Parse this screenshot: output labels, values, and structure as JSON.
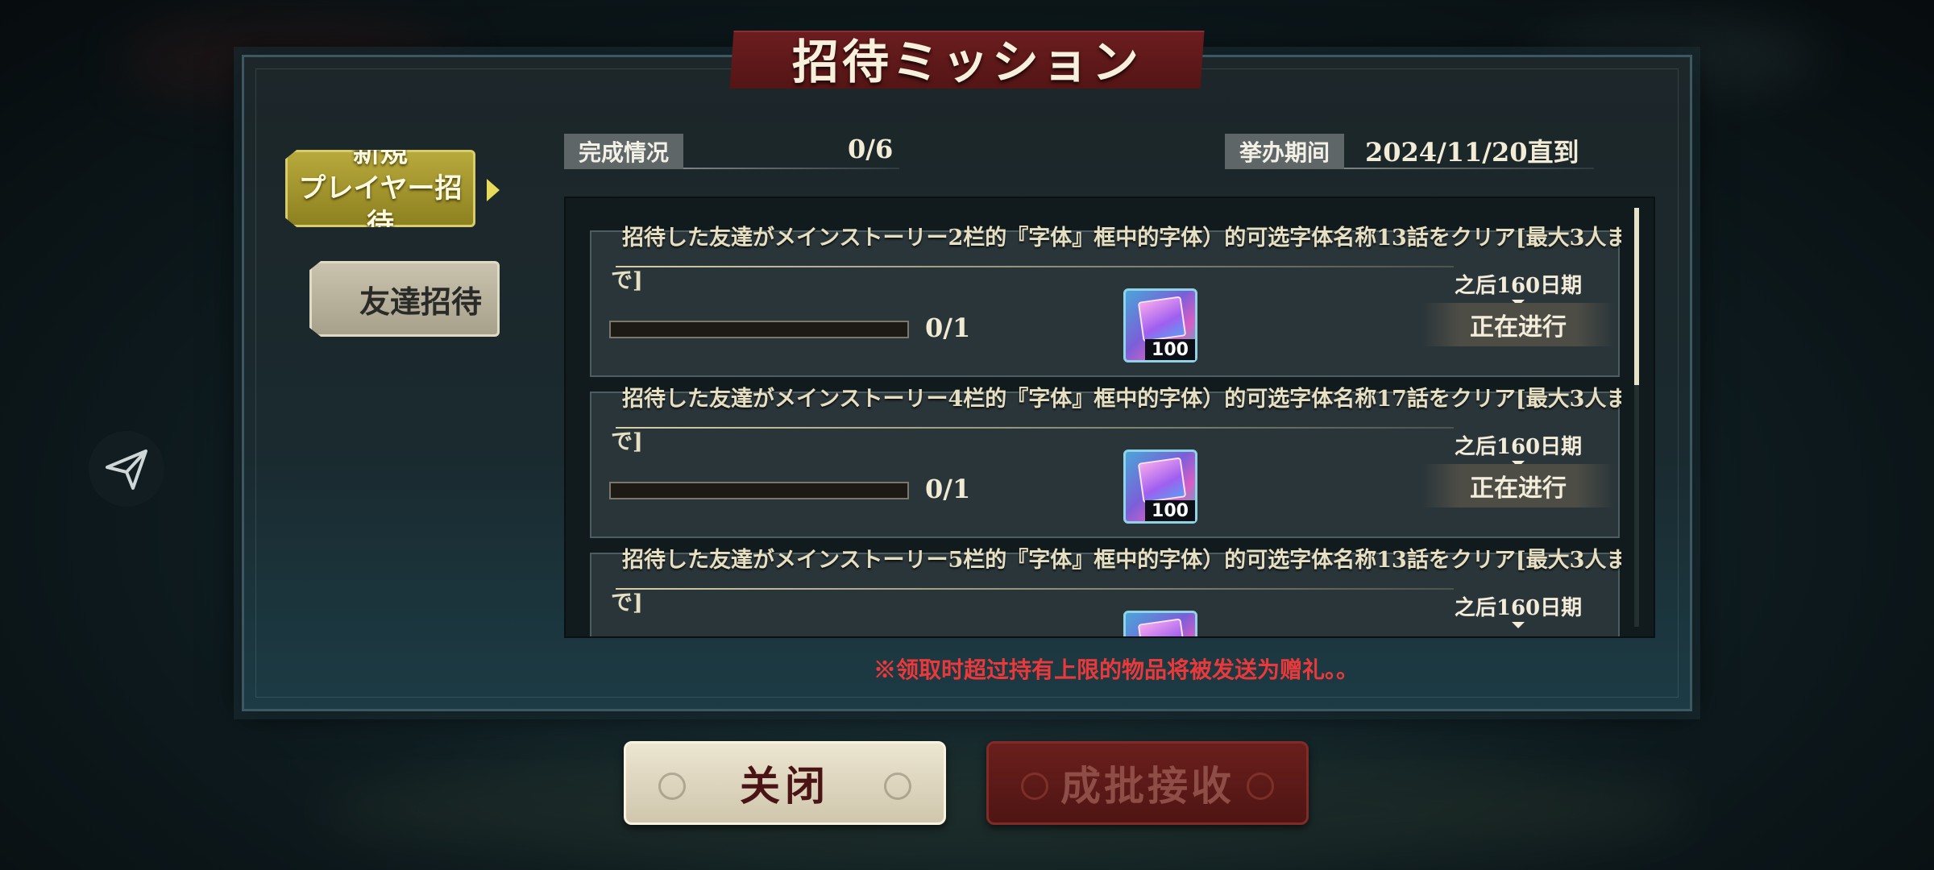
{
  "title": "招待ミッション",
  "tabs": [
    {
      "label": "新規\nプレイヤー招待",
      "active": true
    },
    {
      "label": "友達招待",
      "active": false
    }
  ],
  "summary": {
    "completion_label": "完成情况",
    "completion_value": "0/6",
    "period_label": "挙办期间",
    "period_value": "2024/11/20直到"
  },
  "missions": [
    {
      "desc_line1": "招待した友達がメインストーリー2栏的『字体』框中的字体）的可选字体名称13話をクリア[最大3人ま",
      "desc_line2": "で]",
      "progress_text": "0/1",
      "progress_fraction": 0,
      "reward_count": "100",
      "reward_icon": "gem-box-icon",
      "deadline": "之后160日期",
      "status": "正在进行"
    },
    {
      "desc_line1": "招待した友達がメインストーリー4栏的『字体』框中的字体）的可选字体名称17話をクリア[最大3人ま",
      "desc_line2": "で]",
      "progress_text": "0/1",
      "progress_fraction": 0,
      "reward_count": "100",
      "reward_icon": "gem-box-icon",
      "deadline": "之后160日期",
      "status": "正在进行"
    },
    {
      "desc_line1": "招待した友達がメインストーリー5栏的『字体』框中的字体）的可选字体名称13話をクリア[最大3人ま",
      "desc_line2": "で]",
      "progress_text": "",
      "progress_fraction": 0,
      "reward_count": "",
      "reward_icon": "gem-box-icon",
      "deadline": "之后160日期",
      "status": ""
    }
  ],
  "warning": "※领取时超过持有上限的物品将被发送为赠礼。。",
  "buttons": {
    "close": "关闭",
    "batch_receive": "成批接收"
  },
  "colors": {
    "active_tab": "#b8a93c",
    "title_banner": "#6b1d1e",
    "warning": "#e9393b",
    "batch_button": "#6a1f1c"
  }
}
